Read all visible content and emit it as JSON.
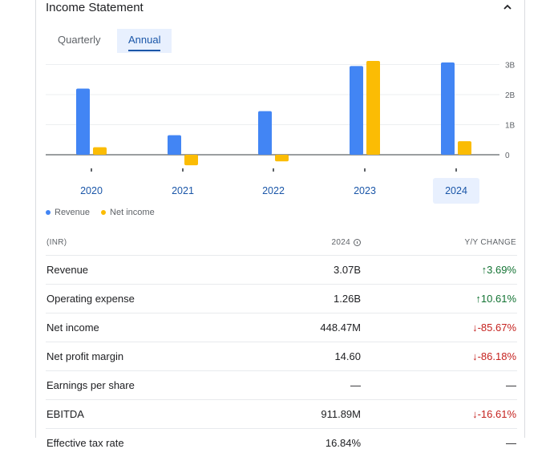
{
  "header": {
    "title": "Income Statement",
    "collapse_icon": "chevron-up-icon"
  },
  "tabs": [
    {
      "label": "Quarterly",
      "active": false
    },
    {
      "label": "Annual",
      "active": true
    }
  ],
  "chart_data": {
    "type": "bar",
    "categories": [
      "2020",
      "2021",
      "2022",
      "2023",
      "2024"
    ],
    "selected_category": "2024",
    "series": [
      {
        "name": "Revenue",
        "color": "#4285f4",
        "values": [
          2.2,
          0.65,
          1.45,
          2.95,
          3.07
        ]
      },
      {
        "name": "Net income",
        "color": "#fbbc04",
        "values": [
          0.25,
          -0.35,
          -0.22,
          3.12,
          0.45
        ]
      }
    ],
    "y_ticks": [
      "3B",
      "2B",
      "1B",
      "0"
    ],
    "y_tick_values": [
      3,
      2,
      1,
      0
    ],
    "ylim": [
      -0.45,
      3.2
    ],
    "ylabel_unit": "B",
    "grid": true
  },
  "legend": [
    {
      "label": "Revenue",
      "color": "#4285f4"
    },
    {
      "label": "Net income",
      "color": "#fbbc04"
    }
  ],
  "table": {
    "headers": [
      "(INR)",
      "2024",
      "Y/Y CHANGE"
    ],
    "rows": [
      {
        "label": "Revenue",
        "value": "3.07B",
        "change": "3.69%",
        "dir": "up"
      },
      {
        "label": "Operating expense",
        "value": "1.26B",
        "change": "10.61%",
        "dir": "up"
      },
      {
        "label": "Net income",
        "value": "448.47M",
        "change": "-85.67%",
        "dir": "down"
      },
      {
        "label": "Net profit margin",
        "value": "14.60",
        "change": "-86.18%",
        "dir": "down"
      },
      {
        "label": "Earnings per share",
        "value": "—",
        "change": "—",
        "dir": "none"
      },
      {
        "label": "EBITDA",
        "value": "911.89M",
        "change": "-16.61%",
        "dir": "down"
      },
      {
        "label": "Effective tax rate",
        "value": "16.84%",
        "change": "—",
        "dir": "none"
      }
    ]
  }
}
